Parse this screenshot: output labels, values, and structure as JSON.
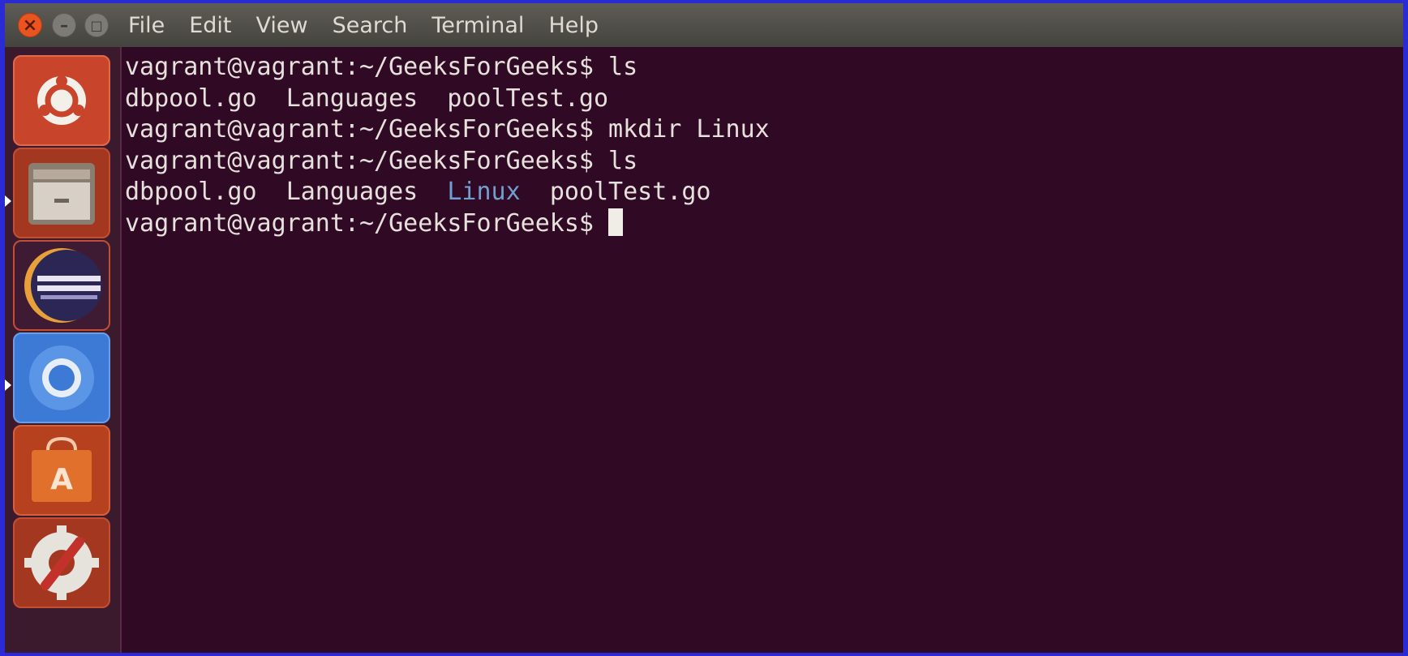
{
  "window": {
    "close_glyph": "×",
    "minimize_glyph": "–",
    "maximize_glyph": "□"
  },
  "menu": {
    "items": [
      "File",
      "Edit",
      "View",
      "Search",
      "Terminal",
      "Help"
    ]
  },
  "launcher": {
    "items": [
      {
        "name": "dash-icon",
        "color": "#c8452c"
      },
      {
        "name": "files-icon",
        "color": "#8a7e70"
      },
      {
        "name": "eclipse-icon",
        "color": "#2c2655"
      },
      {
        "name": "chromium-icon",
        "color": "#3d7ad6"
      },
      {
        "name": "software-center-icon",
        "color": "#e0702c"
      },
      {
        "name": "system-settings-icon",
        "color": "#c2322b"
      }
    ]
  },
  "terminal": {
    "lines": [
      {
        "prompt": "vagrant@vagrant:~/GeeksForGeeks$",
        "command": "ls"
      },
      {
        "output": [
          "dbpool.go",
          "Languages",
          "poolTest.go"
        ]
      },
      {
        "prompt": "vagrant@vagrant:~/GeeksForGeeks$",
        "command": "mkdir Linux"
      },
      {
        "prompt": "vagrant@vagrant:~/GeeksForGeeks$",
        "command": "ls"
      },
      {
        "output": [
          "dbpool.go",
          "Languages",
          "Linux",
          "poolTest.go"
        ],
        "directory": "Linux"
      },
      {
        "prompt": "vagrant@vagrant:~/GeeksForGeeks$",
        "command": ""
      }
    ],
    "colors": {
      "background": "#300a24",
      "text": "#e6e1dc",
      "directory": "#729fcf"
    }
  }
}
